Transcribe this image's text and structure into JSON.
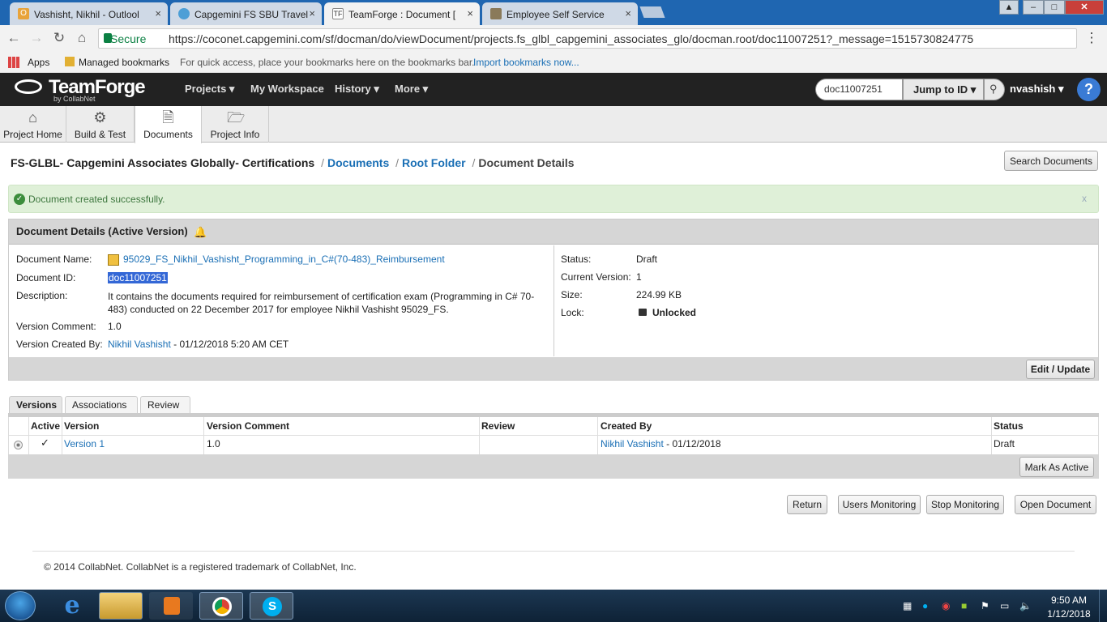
{
  "browser": {
    "tabs": [
      {
        "title": "Vashisht, Nikhil - Outlool",
        "icon": "outlook-icon",
        "active": false
      },
      {
        "title": "Capgemini FS SBU Travel",
        "icon": "capgemini-icon",
        "active": false
      },
      {
        "title": "TeamForge : Document [",
        "icon": "teamforge-icon",
        "active": true
      },
      {
        "title": "Employee Self Service",
        "icon": "ess-icon",
        "active": false
      }
    ],
    "close_glyph": "×",
    "secure_label": "Secure",
    "url": "https://coconet.capgemini.com/sf/docman/do/viewDocument/projects.fs_glbl_capgemini_associates_glo/docman.root/doc11007251?_message=1515730824775",
    "bookmarks": {
      "apps": "Apps",
      "managed": "Managed bookmarks",
      "hint": "For quick access, place your bookmarks here on the bookmarks bar.",
      "import": "Import bookmarks now..."
    }
  },
  "header": {
    "logo": "TeamForge",
    "logo_sub": "by CollabNet",
    "nav": [
      "Projects",
      "My Workspace",
      "History",
      "More"
    ],
    "jump_value": "doc11007251",
    "jump_label": "Jump to ID",
    "user": "nvashish",
    "help": "?"
  },
  "project_tabs": [
    {
      "label": "Project Home",
      "icon": "home-icon"
    },
    {
      "label": "Build & Test",
      "icon": "build-icon"
    },
    {
      "label": "Documents",
      "icon": "document-icon",
      "active": true
    },
    {
      "label": "Project Info",
      "icon": "folder-icon"
    }
  ],
  "breadcrumb": {
    "project": "FS-GLBL- Capgemini Associates Globally- Certifications",
    "documents": "Documents",
    "root": "Root Folder",
    "current": "Document Details"
  },
  "search_docs": "Search Documents",
  "alert": {
    "message": "Document created successfully.",
    "close": "x"
  },
  "details": {
    "title": "Document Details (Active Version)",
    "labels": {
      "name": "Document Name:",
      "id": "Document ID:",
      "description": "Description:",
      "version_comment": "Version Comment:",
      "created_by": "Version Created By:",
      "status": "Status:",
      "current_version": "Current Version:",
      "size": "Size:",
      "lock": "Lock:"
    },
    "name": "95029_FS_Nikhil_Vashisht_Programming_in_C#(70-483)_Reimbursement",
    "id": "doc11007251",
    "description": "It contains the documents required for reimbursement of certification exam (Programming in C# 70-483) conducted on 22 December 2017 for employee Nikhil Vashisht 95029_FS.",
    "version_comment": "1.0",
    "created_by_name": "Nikhil Vashisht",
    "created_by_date": " - 01/12/2018 5:20 AM CET",
    "status": "Draft",
    "current_version": "1",
    "size": "224.99 KB",
    "lock": "Unlocked",
    "edit_button": "Edit / Update"
  },
  "version_tabs": [
    "Versions",
    "Associations",
    "Review"
  ],
  "versions_table": {
    "columns": [
      "Active",
      "Version",
      "Version Comment",
      "Review",
      "Created By",
      "Status"
    ],
    "rows": [
      {
        "active": "✓",
        "version": "Version 1",
        "comment": "1.0",
        "review": "",
        "created_by": "Nikhil Vashisht",
        "created_date": " - 01/12/2018",
        "status": "Draft"
      }
    ],
    "mark_active": "Mark As Active"
  },
  "actions": [
    "Return",
    "Users Monitoring",
    "Stop Monitoring",
    "Open Document"
  ],
  "footer": "© 2014 CollabNet. CollabNet is a registered trademark of CollabNet, Inc.",
  "taskbar": {
    "time": "9:50 AM",
    "date": "1/12/2018",
    "apps": [
      "ie-icon",
      "explorer-icon",
      "media-player-icon",
      "chrome-icon",
      "skype-icon"
    ]
  }
}
